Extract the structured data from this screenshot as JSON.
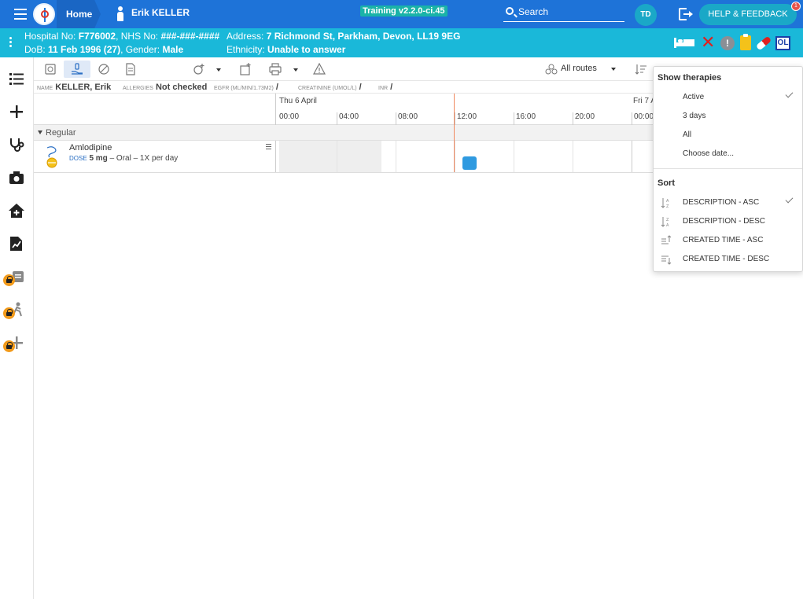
{
  "header": {
    "home_label": "Home",
    "patient_name": "Erik KELLER",
    "version": "Training v2.2.0-ci.45",
    "search_label": "Search",
    "user_initials": "TD",
    "help_label": "HELP & FEEDBACK",
    "notification_count": "1",
    "brand_color": "#1e73d8",
    "accent_color": "#1ab8d9"
  },
  "patient_info": {
    "hospital_label": "Hospital No:",
    "hospital_no": "F776002",
    "nhs_label": ", NHS No:",
    "nhs_no": "###-###-####",
    "address_label": "Address:",
    "address": "7 Richmond St, Parkham, Devon, LL19 9EG",
    "dob_label": "DoB:",
    "dob": "11 Feb 1996 (27)",
    "gender_label": ", Gender:",
    "gender": "Male",
    "ethnicity_label": "Ethnicity:",
    "ethnicity": "Unable to answer",
    "ol_badge": "OL",
    "status_icons": [
      "bed-icon",
      "allergy-x-icon",
      "alert-icon",
      "clipboard-icon",
      "pill-icon",
      "ol-badge"
    ]
  },
  "left_nav": {
    "icons": [
      "list-icon",
      "plus-icon",
      "stethoscope-icon",
      "camera-icon",
      "home-plus-icon",
      "document-chart-icon",
      "locked-report-icon",
      "locked-walking-icon",
      "locked-plus-icon"
    ]
  },
  "toolbar": {
    "icons": [
      "medication-chart-icon",
      "hand-dose-icon",
      "pill-icon",
      "document-icon",
      "add-therapy-icon",
      "add-order-icon",
      "print-icon",
      "warning-icon",
      "sort-icon"
    ],
    "routes_label": "All routes"
  },
  "patient_strip": {
    "name_label": "NAME",
    "name": "KELLER, Erik",
    "allergies_label": "ALLERGIES",
    "allergies": "Not checked",
    "egfr_label": "EGFR (ML/MIN/1.73M2)",
    "egfr": "/",
    "creatinine_label": "CREATININE (UMOL/L)",
    "creatinine": "/",
    "inr_label": "INR",
    "inr": "/"
  },
  "timeline": {
    "day1": "Thu 6 April",
    "day2": "Fri 7 A",
    "hours": [
      "00:00",
      "04:00",
      "08:00",
      "12:00",
      "16:00",
      "20:00",
      "00:00"
    ]
  },
  "therapy_group": {
    "label": "Regular"
  },
  "medication": {
    "name": "Amlodipine",
    "dose_label": "DOSE",
    "dose": "5 mg",
    "route_freq": "– Oral – 1X per day"
  },
  "dropdown": {
    "show_header": "Show therapies",
    "show_items": [
      {
        "label": "Active",
        "checked": true
      },
      {
        "label": "3 days",
        "checked": false
      },
      {
        "label": "All",
        "checked": false
      },
      {
        "label": "Choose date...",
        "checked": false
      }
    ],
    "sort_header": "Sort",
    "sort_items": [
      {
        "label": "DESCRIPTION - ASC",
        "icon": "sort-alpha-asc-icon",
        "checked": true
      },
      {
        "label": "DESCRIPTION - DESC",
        "icon": "sort-alpha-desc-icon",
        "checked": false
      },
      {
        "label": "CREATED TIME - ASC",
        "icon": "sort-time-asc-icon",
        "checked": false
      },
      {
        "label": "CREATED TIME - DESC",
        "icon": "sort-time-desc-icon",
        "checked": false
      }
    ]
  }
}
